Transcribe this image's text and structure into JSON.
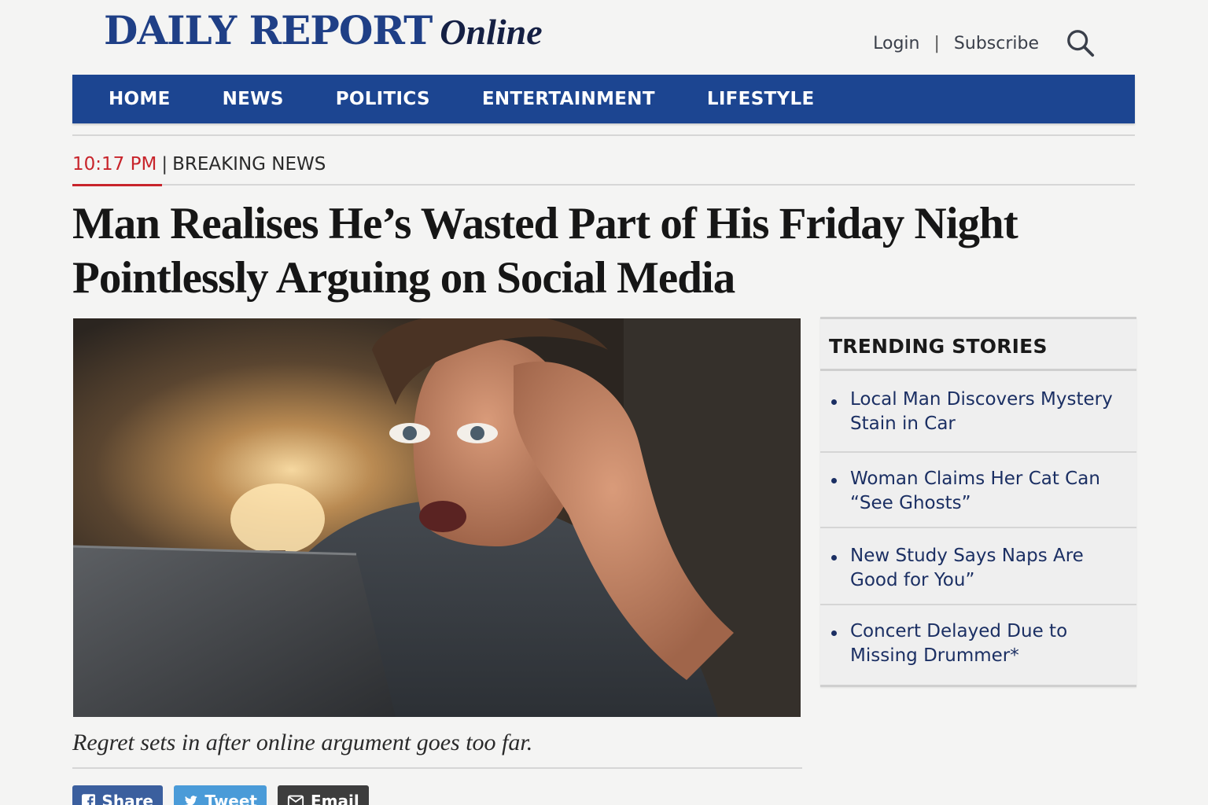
{
  "site": {
    "logo_main": "DAILY REPORT",
    "logo_suffix": "Online",
    "brand_color": "#1f3f86"
  },
  "header": {
    "login": "Login",
    "separator": "|",
    "subscribe": "Subscribe",
    "search_icon": "search-icon"
  },
  "nav": {
    "items": [
      "HOME",
      "NEWS",
      "POLITICS",
      "ENTERTAINMENT",
      "LIFESTYLE"
    ],
    "bg_color": "#1c4591"
  },
  "article": {
    "time": "10:17 PM",
    "divider": "|",
    "category": "BREAKING NEWS",
    "headline": "Man Realises He’s Wasted Part of His Friday Night Pointlessly Arguing on Social Media",
    "caption": "Regret sets in after online argument goes too far.",
    "accent_color": "#c8242b"
  },
  "share": {
    "facebook": "Share",
    "twitter": "Tweet",
    "email": "Email"
  },
  "trending": {
    "title": "TRENDING STORIES",
    "items": [
      "Local Man Discovers Mystery Stain in Car",
      "Woman Claims Her Cat Can “See Ghosts”",
      "New Study Says Naps Are Good for You”",
      "Concert Delayed Due to Missing Drummer*"
    ]
  }
}
